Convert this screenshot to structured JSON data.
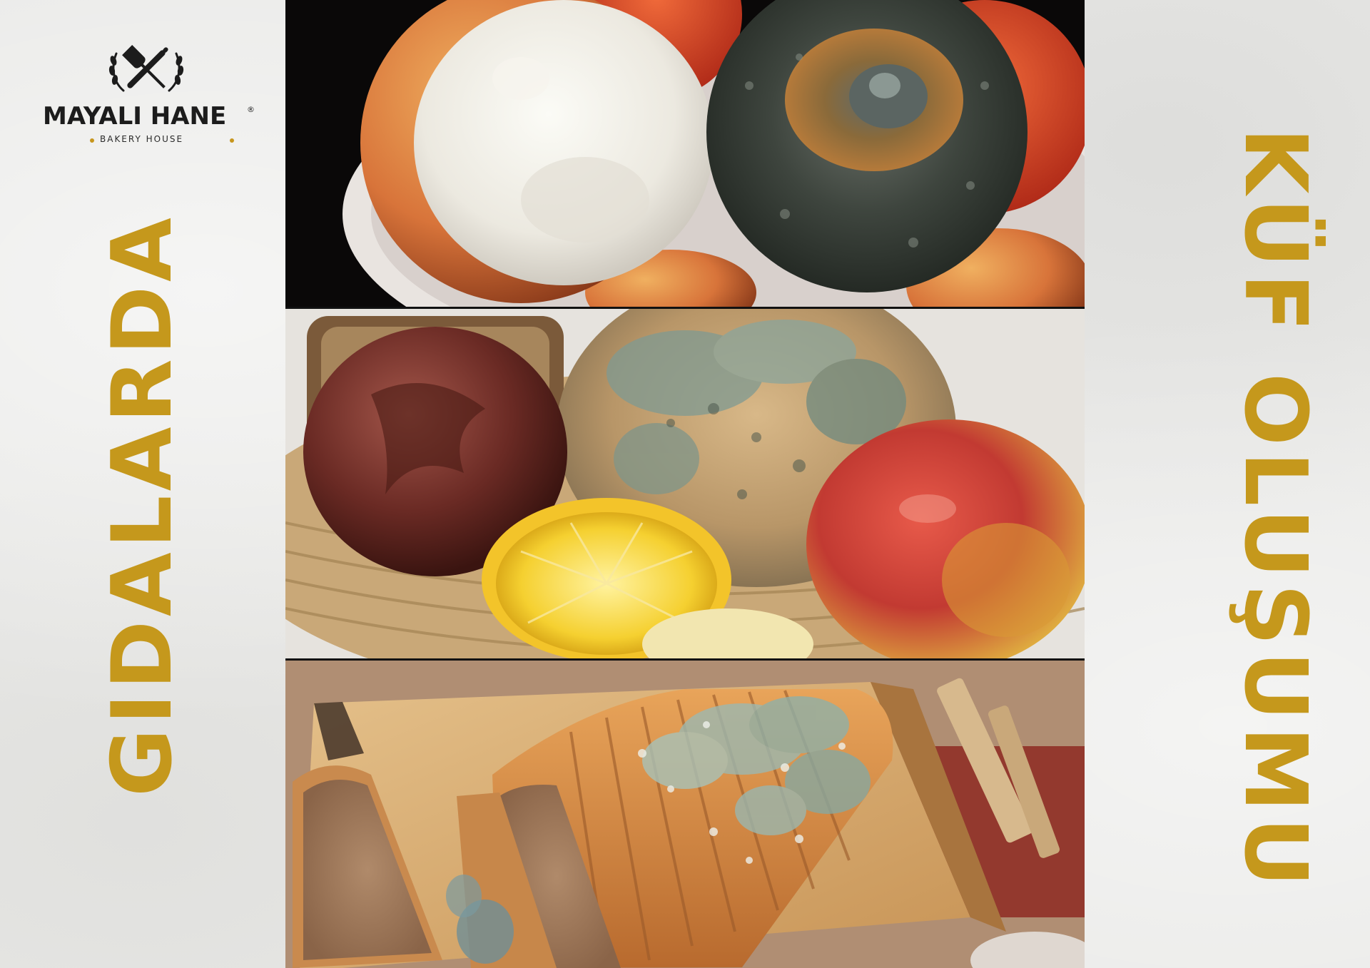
{
  "logo": {
    "name": "MAYALI HANE",
    "registered_mark": "®",
    "tagline": "BAKERY HOUSE",
    "icon": "crossed-rolling-pin-and-spatula-with-wheat-wreath"
  },
  "headline": {
    "left": "GIDALARDA",
    "right": "KÜF OLUŞUMU"
  },
  "photos": [
    {
      "subject": "moldy-peaches-in-bowl"
    },
    {
      "subject": "moldy-bread-rotten-fruit-in-basket"
    },
    {
      "subject": "moldy-sliced-bread-on-board"
    }
  ],
  "colors": {
    "accent": "#c5981c",
    "background": "#e9e9e7",
    "logo_text": "#1c1c1c"
  }
}
